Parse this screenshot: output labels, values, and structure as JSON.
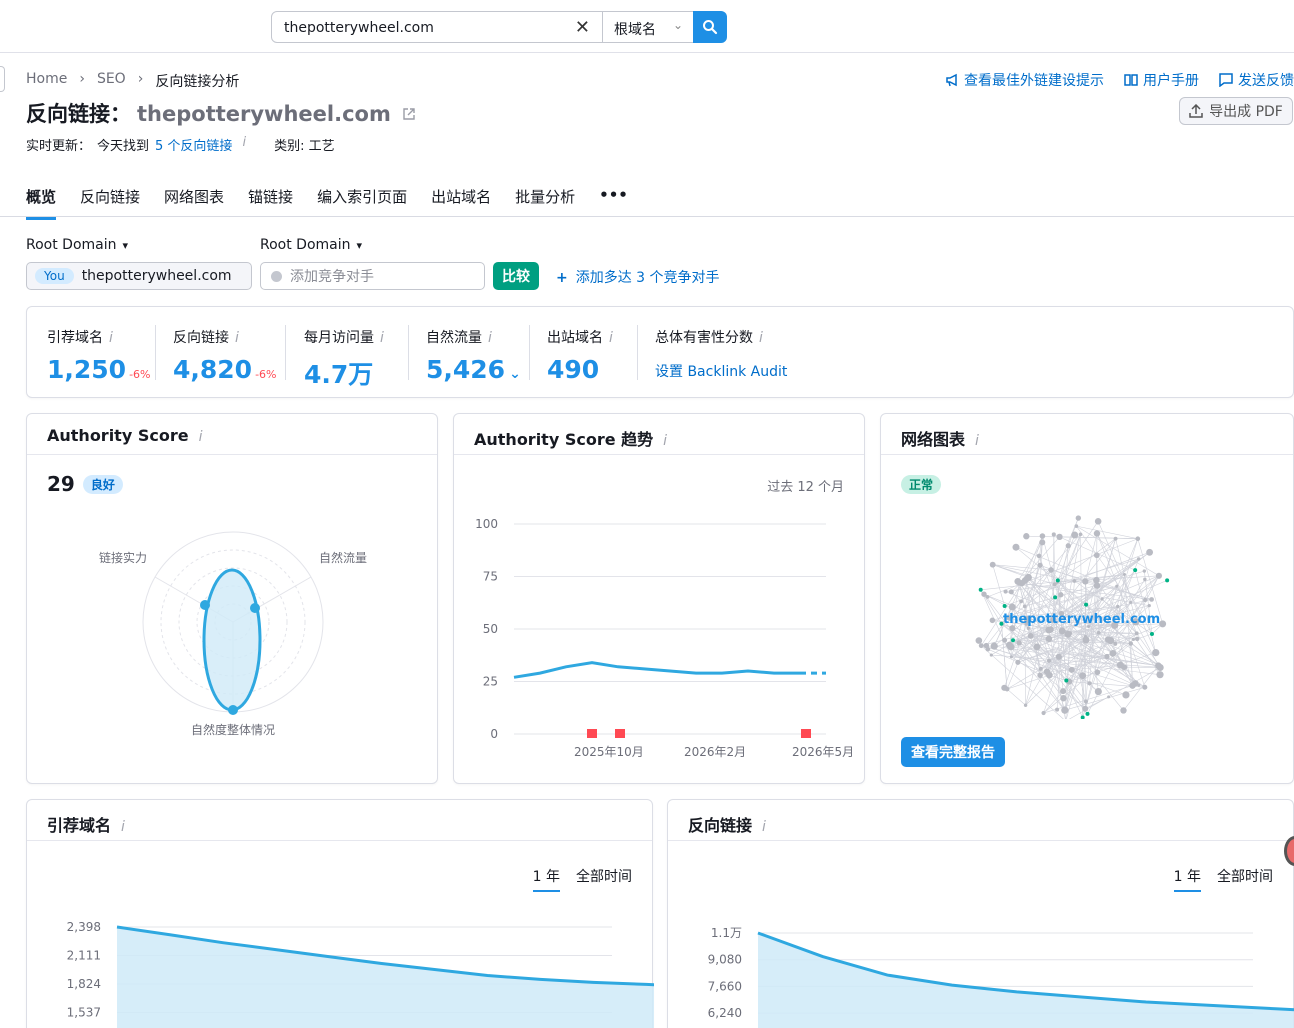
{
  "search": {
    "value": "thepotterywheel.com",
    "scope": "根域名"
  },
  "breadcrumb": [
    "Home",
    "SEO",
    "反向链接分析"
  ],
  "toplinks": {
    "tips": "查看最佳外链建设提示",
    "manual": "用户手册",
    "feedback": "发送反馈"
  },
  "header": {
    "title_prefix": "反向链接：",
    "domain": "thepotterywheel.com",
    "export": "导出成 PDF",
    "realtime_label": "实时更新：",
    "realtime_text": "今天找到",
    "realtime_link": "5 个反向链接",
    "category": "类别: 工艺"
  },
  "tabs": [
    "概览",
    "反向链接",
    "网络图表",
    "锚链接",
    "编入索引页面",
    "出站域名",
    "批量分析",
    "•••"
  ],
  "compare": {
    "dropdown1": "Root Domain",
    "dropdown2": "Root Domain",
    "you_tag": "You",
    "you_domain": "thepotterywheel.com",
    "competitor_placeholder": "添加竞争对手",
    "compare_btn": "比较",
    "add_competitors": "添加多达 3 个竞争对手"
  },
  "metrics": [
    {
      "label": "引荐域名",
      "value": "1,250",
      "change": "-6%"
    },
    {
      "label": "反向链接",
      "value": "4,820",
      "change": "-6%"
    },
    {
      "label": "每月访问量",
      "value": "4.7万",
      "change": ""
    },
    {
      "label": "自然流量",
      "value": "5,426",
      "change": ""
    },
    {
      "label": "出站域名",
      "value": "490",
      "change": ""
    },
    {
      "label": "总体有害性分数",
      "value": "",
      "link": "设置 Backlink Audit"
    }
  ],
  "authority": {
    "title": "Authority Score",
    "score": "29",
    "badge": "良好",
    "axes": [
      "链接实力",
      "自然流量",
      "自然度整体情况"
    ]
  },
  "trend": {
    "title": "Authority Score 趋势",
    "period": "过去 12 个月",
    "chart_data": {
      "type": "line",
      "ylim": [
        0,
        100
      ],
      "yticks": [
        "100",
        "75",
        "50",
        "25",
        "0"
      ],
      "xticks": [
        "2025年10月",
        "2026年2月",
        "2026年5月"
      ],
      "values": [
        27,
        29,
        32,
        34,
        32,
        31,
        30,
        29,
        29,
        30,
        29,
        29,
        29
      ],
      "flags": 3
    }
  },
  "network": {
    "title": "网络图表",
    "badge": "正常",
    "center": "thepotterywheel.com",
    "button": "查看完整报告"
  },
  "refdomains": {
    "title": "引荐域名",
    "toggle": [
      "1 年",
      "全部时间"
    ],
    "chart_data": {
      "type": "area",
      "yticks": [
        "2,398",
        "2,111",
        "1,824",
        "1,537"
      ],
      "values": [
        2398,
        2320,
        2240,
        2170,
        2100,
        2030,
        1970,
        1910,
        1870,
        1840,
        1820,
        1800
      ]
    }
  },
  "backlinks": {
    "title": "反向链接",
    "toggle": [
      "1 年",
      "全部时间"
    ],
    "chart_data": {
      "type": "area",
      "yticks": [
        "1.1万",
        "9,080",
        "7,660",
        "6,240"
      ],
      "values": [
        11000,
        9600,
        8500,
        7900,
        7500,
        7200,
        6900,
        6700,
        6500,
        6300
      ]
    }
  },
  "colors": {
    "accent": "#1e8fe5",
    "link": "#006dca",
    "negative": "#ff4953",
    "green": "#009f81",
    "flag": "#ff4953"
  }
}
